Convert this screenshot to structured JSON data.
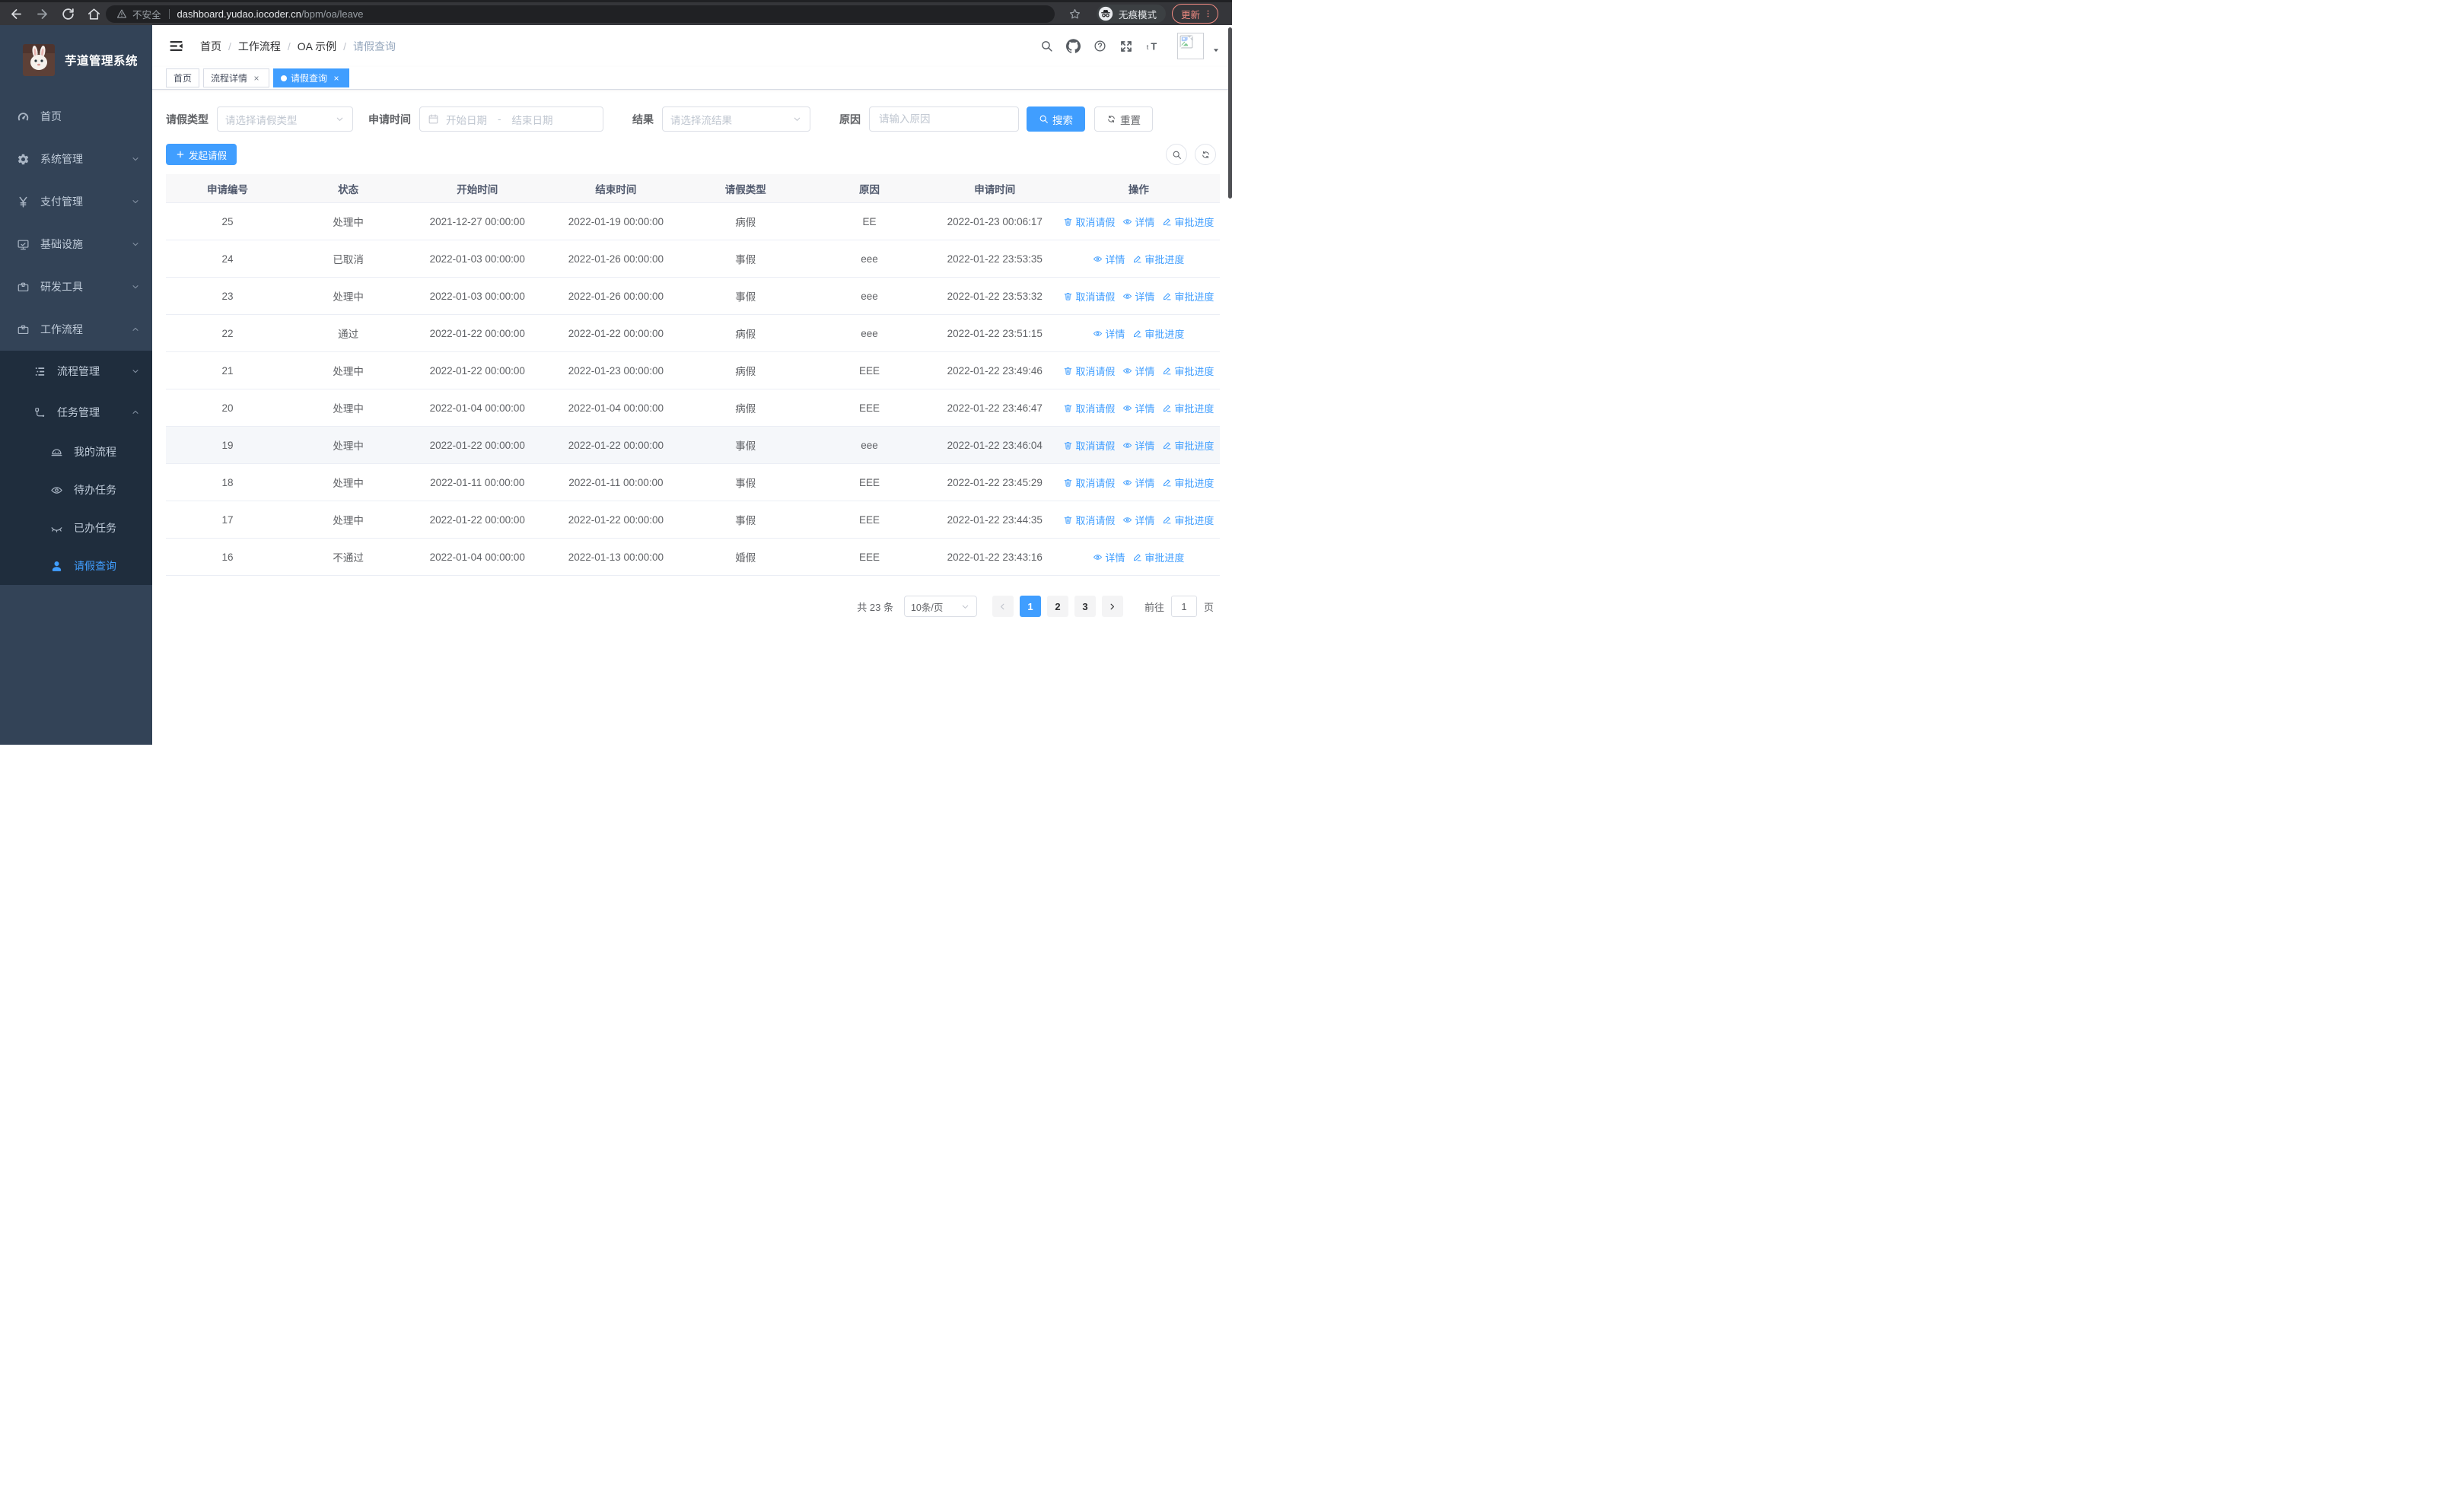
{
  "browser": {
    "security_label": "不安全",
    "url_host": "dashboard.yudao.iocoder.cn",
    "url_path": "/bpm/oa/leave",
    "incognito_label": "无痕模式",
    "update_label": "更新"
  },
  "sidebar": {
    "title": "芋道管理系统",
    "items": [
      {
        "key": "home",
        "label": "首页",
        "icon": "dashboard-icon",
        "level": 1
      },
      {
        "key": "system",
        "label": "系统管理",
        "icon": "gear-icon",
        "level": 1,
        "chevron": "down"
      },
      {
        "key": "payment",
        "label": "支付管理",
        "icon": "yen-icon",
        "level": 1,
        "chevron": "down"
      },
      {
        "key": "infra",
        "label": "基础设施",
        "icon": "monitor-icon",
        "level": 1,
        "chevron": "down"
      },
      {
        "key": "devtools",
        "label": "研发工具",
        "icon": "toolbox-icon",
        "level": 1,
        "chevron": "down"
      },
      {
        "key": "workflow",
        "label": "工作流程",
        "icon": "briefcase-icon",
        "level": 1,
        "chevron": "up"
      },
      {
        "key": "process-mgmt",
        "label": "流程管理",
        "icon": "list-tree-icon",
        "level": 2,
        "chevron": "down",
        "sub": true
      },
      {
        "key": "task-mgmt",
        "label": "任务管理",
        "icon": "flow-icon",
        "level": 2,
        "chevron": "up",
        "sub": true
      },
      {
        "key": "my-process",
        "label": "我的流程",
        "icon": "robot-icon",
        "level": 3,
        "sub": true
      },
      {
        "key": "todo-tasks",
        "label": "待办任务",
        "icon": "eye-open-icon",
        "level": 3,
        "sub": true
      },
      {
        "key": "done-tasks",
        "label": "已办任务",
        "icon": "eye-closed-icon",
        "level": 3,
        "sub": true
      },
      {
        "key": "leave-query",
        "label": "请假查询",
        "icon": "user-icon",
        "level": 3,
        "sub": true,
        "active": true
      }
    ]
  },
  "header": {
    "separator": "/",
    "breadcrumb": [
      {
        "label": "首页"
      },
      {
        "label": "工作流程"
      },
      {
        "label": "OA 示例"
      },
      {
        "label": "请假查询",
        "current": true
      }
    ]
  },
  "tabs": [
    {
      "key": "home",
      "label": "首页"
    },
    {
      "key": "process-detail",
      "label": "流程详情",
      "closable": true
    },
    {
      "key": "leave-query",
      "label": "请假查询",
      "closable": true,
      "active": true
    }
  ],
  "filters": {
    "leave_type_label": "请假类型",
    "leave_type_placeholder": "请选择请假类型",
    "apply_time_label": "申请时间",
    "start_placeholder": "开始日期",
    "range_separator": "-",
    "end_placeholder": "结束日期",
    "result_label": "结果",
    "result_placeholder": "请选择流结果",
    "reason_label": "原因",
    "reason_placeholder": "请输入原因",
    "search_label": "搜索",
    "reset_label": "重置"
  },
  "toolbar": {
    "create_label": "发起请假"
  },
  "table": {
    "columns": [
      "申请编号",
      "状态",
      "开始时间",
      "结束时间",
      "请假类型",
      "原因",
      "申请时间",
      "操作"
    ],
    "action_labels": {
      "cancel": "取消请假",
      "detail": "详情",
      "progress": "审批进度"
    },
    "action_icons": {
      "cancel": "delete-icon",
      "detail": "view-icon",
      "progress": "edit-icon"
    },
    "rows": [
      {
        "id": "25",
        "status": "处理中",
        "start": "2021-12-27 00:00:00",
        "end": "2022-01-19 00:00:00",
        "type": "病假",
        "reason": "EE",
        "applied": "2022-01-23 00:06:17",
        "actions": [
          "cancel",
          "detail",
          "progress"
        ]
      },
      {
        "id": "24",
        "status": "已取消",
        "start": "2022-01-03 00:00:00",
        "end": "2022-01-26 00:00:00",
        "type": "事假",
        "reason": "eee",
        "applied": "2022-01-22 23:53:35",
        "actions": [
          "detail",
          "progress"
        ]
      },
      {
        "id": "23",
        "status": "处理中",
        "start": "2022-01-03 00:00:00",
        "end": "2022-01-26 00:00:00",
        "type": "事假",
        "reason": "eee",
        "applied": "2022-01-22 23:53:32",
        "actions": [
          "cancel",
          "detail",
          "progress"
        ]
      },
      {
        "id": "22",
        "status": "通过",
        "start": "2022-01-22 00:00:00",
        "end": "2022-01-22 00:00:00",
        "type": "病假",
        "reason": "eee",
        "applied": "2022-01-22 23:51:15",
        "actions": [
          "detail",
          "progress"
        ]
      },
      {
        "id": "21",
        "status": "处理中",
        "start": "2022-01-22 00:00:00",
        "end": "2022-01-23 00:00:00",
        "type": "病假",
        "reason": "EEE",
        "applied": "2022-01-22 23:49:46",
        "actions": [
          "cancel",
          "detail",
          "progress"
        ]
      },
      {
        "id": "20",
        "status": "处理中",
        "start": "2022-01-04 00:00:00",
        "end": "2022-01-04 00:00:00",
        "type": "病假",
        "reason": "EEE",
        "applied": "2022-01-22 23:46:47",
        "actions": [
          "cancel",
          "detail",
          "progress"
        ]
      },
      {
        "id": "19",
        "status": "处理中",
        "start": "2022-01-22 00:00:00",
        "end": "2022-01-22 00:00:00",
        "type": "事假",
        "reason": "eee",
        "applied": "2022-01-22 23:46:04",
        "actions": [
          "cancel",
          "detail",
          "progress"
        ],
        "highlight": true
      },
      {
        "id": "18",
        "status": "处理中",
        "start": "2022-01-11 00:00:00",
        "end": "2022-01-11 00:00:00",
        "type": "事假",
        "reason": "EEE",
        "applied": "2022-01-22 23:45:29",
        "actions": [
          "cancel",
          "detail",
          "progress"
        ]
      },
      {
        "id": "17",
        "status": "处理中",
        "start": "2022-01-22 00:00:00",
        "end": "2022-01-22 00:00:00",
        "type": "事假",
        "reason": "EEE",
        "applied": "2022-01-22 23:44:35",
        "actions": [
          "cancel",
          "detail",
          "progress"
        ]
      },
      {
        "id": "16",
        "status": "不通过",
        "start": "2022-01-04 00:00:00",
        "end": "2022-01-13 00:00:00",
        "type": "婚假",
        "reason": "EEE",
        "applied": "2022-01-22 23:43:16",
        "actions": [
          "detail",
          "progress"
        ]
      }
    ]
  },
  "pagination": {
    "total": "共 23 条",
    "page_size": "10条/页",
    "pages": [
      "1",
      "2",
      "3"
    ],
    "active": "1",
    "goto_label": "前往",
    "goto_value": "1",
    "unit_label": "页"
  },
  "colors": {
    "accent": "#409eff",
    "sidebar_bg": "#334357",
    "submenu_bg": "#1f2d3d",
    "update_badge": "#f28b82",
    "table_border": "#ebeef5"
  }
}
